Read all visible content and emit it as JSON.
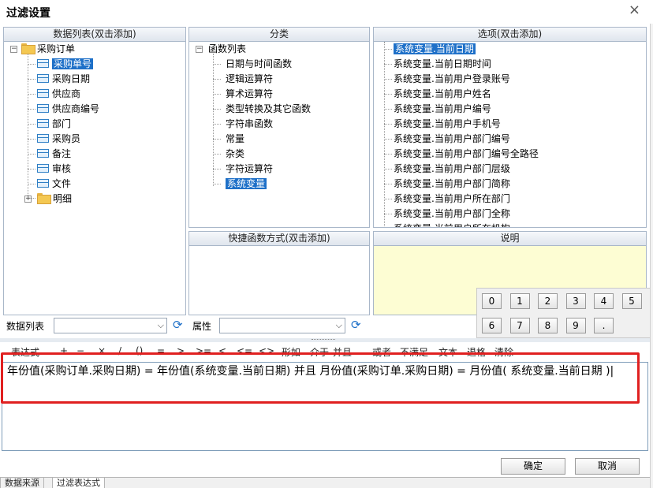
{
  "window": {
    "title": "过滤设置",
    "close_glyph": "×"
  },
  "data_list_panel": {
    "header": "数据列表(双击添加)",
    "root": {
      "expander": "−",
      "label": "采购订单"
    },
    "fields": [
      "采购单号",
      "采购日期",
      "供应商",
      "供应商编号",
      "部门",
      "采购员",
      "备注",
      "审核",
      "文件"
    ],
    "selected_field": "采购单号",
    "child_folder": {
      "expander": "+",
      "label": "明细"
    }
  },
  "category_panel": {
    "header": "分类",
    "root": {
      "expander": "−",
      "label": "函数列表"
    },
    "items": [
      "日期与时间函数",
      "逻辑运算符",
      "算术运算符",
      "类型转换及其它函数",
      "字符串函数",
      "常量",
      "杂类",
      "字符运算符",
      "系统变量"
    ],
    "selected_item": "系统变量"
  },
  "options_panel": {
    "header": "选项(双击添加)",
    "items": [
      "系统变量.当前日期",
      "系统变量.当前日期时间",
      "系统变量.当前用户登录账号",
      "系统变量.当前用户姓名",
      "系统变量.当前用户编号",
      "系统变量.当前用户手机号",
      "系统变量.当前用户部门编号",
      "系统变量.当前用户部门编号全路径",
      "系统变量.当前用户部门层级",
      "系统变量.当前用户部门简称",
      "系统变量.当前用户所在部门",
      "系统变量.当前用户部门全称",
      "系统变量.当前用户所在机构"
    ],
    "selected_item": "系统变量.当前日期"
  },
  "shortcut_panel": {
    "header": "快捷函数方式(双击添加)"
  },
  "description_panel": {
    "header": "说明"
  },
  "numpad": {
    "keys": [
      "0",
      "1",
      "2",
      "3",
      "4",
      "5",
      "6",
      "7",
      "8",
      "9",
      "."
    ]
  },
  "filters": {
    "data_list_label": "数据列表",
    "attribute_label": "属性"
  },
  "operators": {
    "items": [
      "表达式",
      "+",
      "−",
      "×",
      "/",
      "()",
      "=",
      ">",
      ">=",
      "<",
      "<=",
      "<>",
      "形如",
      "介于",
      "并且",
      "或者",
      "不满足",
      "文本",
      "退格",
      "清除"
    ]
  },
  "expression": {
    "text": "年份值(采购订单.采购日期)  =   年份值(系统变量.当前日期)  并且  月份值(采购订单.采购日期)  =   月份值( 系统变量.当前日期 )|"
  },
  "buttons": {
    "ok": "确定",
    "cancel": "取消"
  },
  "tabs": [
    "数据来源",
    "过滤表达式"
  ],
  "colors": {
    "selection": "#1e70c8",
    "highlight_box": "#e02020",
    "description_bg": "#fdfdd3"
  }
}
